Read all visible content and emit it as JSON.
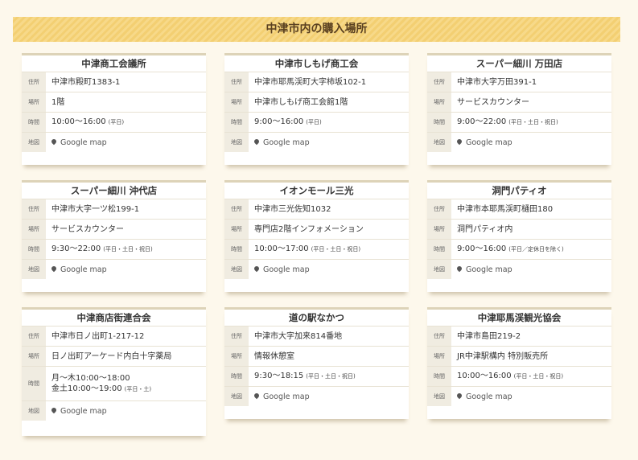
{
  "header": {
    "title": "中津市内の購入場所"
  },
  "labels": {
    "address": "住所",
    "place": "場所",
    "hours": "時間",
    "map": "地図"
  },
  "stores": [
    {
      "name": "中津商工会議所",
      "address": "中津市殿町1383-1",
      "place": "1階",
      "hours": [
        "10:00〜16:00"
      ],
      "hours_note": "(平日)",
      "map_link": "Google map"
    },
    {
      "name": "中津市しもげ商工会",
      "address": "中津市耶馬渓町大字柿坂102-1",
      "place": "中津市しもげ商工会館1階",
      "hours": [
        "9:00〜16:00"
      ],
      "hours_note": "(平日)",
      "map_link": "Google map"
    },
    {
      "name": "スーパー細川 万田店",
      "address": "中津市大字万田391-1",
      "place": "サービスカウンター",
      "hours": [
        "9:00〜22:00"
      ],
      "hours_note": "(平日・土日・祝日)",
      "map_link": "Google map"
    },
    {
      "name": "スーパー細川 沖代店",
      "address": "中津市大字一ツ松199-1",
      "place": "サービスカウンター",
      "hours": [
        "9:30〜22:00"
      ],
      "hours_note": "(平日・土日・祝日)",
      "map_link": "Google map"
    },
    {
      "name": "イオンモール三光",
      "address": "中津市三光佐知1032",
      "place": "専門店2階インフォメーション",
      "hours": [
        "10:00〜17:00"
      ],
      "hours_note": "(平日・土日・祝日)",
      "map_link": "Google map"
    },
    {
      "name": "洞門パティオ",
      "address": "中津市本耶馬渓町樋田180",
      "place": "洞門パティオ内",
      "hours": [
        "9:00〜16:00"
      ],
      "hours_note": "(平日／定休日を除く)",
      "map_link": "Google map"
    },
    {
      "name": "中津商店街連合会",
      "address": "中津市日ノ出町1-217-12",
      "place": "日ノ出町アーケード内白十字薬局",
      "hours": [
        "月〜木10:00〜18:00",
        "金土10:00〜19:00"
      ],
      "hours_note": "(平日・土)",
      "map_link": "Google map"
    },
    {
      "name": "道の駅なかつ",
      "address": "中津市大字加来814番地",
      "place": "情報休憩室",
      "hours": [
        "9:30〜18:15"
      ],
      "hours_note": "(平日・土日・祝日)",
      "map_link": "Google map"
    },
    {
      "name": "中津耶馬渓観光協会",
      "address": "中津市島田219-2",
      "place": "JR中津駅構内 特別販売所",
      "hours": [
        "10:00〜16:00"
      ],
      "hours_note": "(平日・土日・祝日)",
      "map_link": "Google map"
    }
  ]
}
